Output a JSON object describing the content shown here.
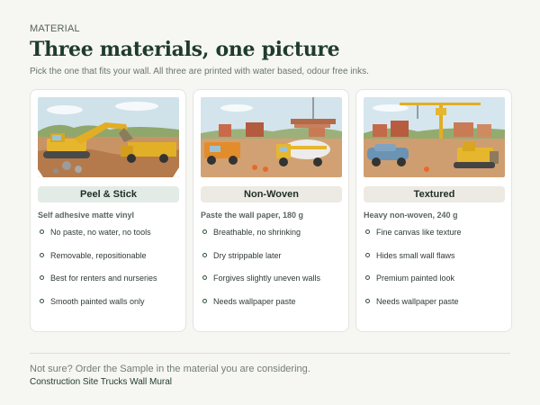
{
  "header": {
    "eyebrow": "MATERIAL",
    "title": "Three materials, one picture",
    "subtitle": "Pick the one that fits your wall. All three are printed with water based, odour free inks."
  },
  "cards": [
    {
      "name": "Peel & Stick",
      "subtitle": "Self adhesive matte vinyl",
      "pill_color": "#e3ebe6",
      "features": [
        "No paste, no water, no tools",
        "Removable, repositionable",
        "Best for renters and nurseries",
        "Smooth painted walls only"
      ]
    },
    {
      "name": "Non-Woven",
      "subtitle": "Paste the wall paper, 180 g",
      "pill_color": "#ede9e3",
      "features": [
        "Breathable, no shrinking",
        "Dry strippable later",
        "Forgives slightly uneven walls",
        "Needs wallpaper paste"
      ]
    },
    {
      "name": "Textured",
      "subtitle": "Heavy non-woven, 240 g",
      "pill_color": "#ede9e3",
      "features": [
        "Fine canvas like texture",
        "Hides small wall flaws",
        "Premium painted look",
        "Needs wallpaper paste"
      ]
    }
  ],
  "footer": {
    "note": "Not sure? Order the Sample in the material you are considering.",
    "product_link": "Construction Site Trucks Wall Mural"
  }
}
